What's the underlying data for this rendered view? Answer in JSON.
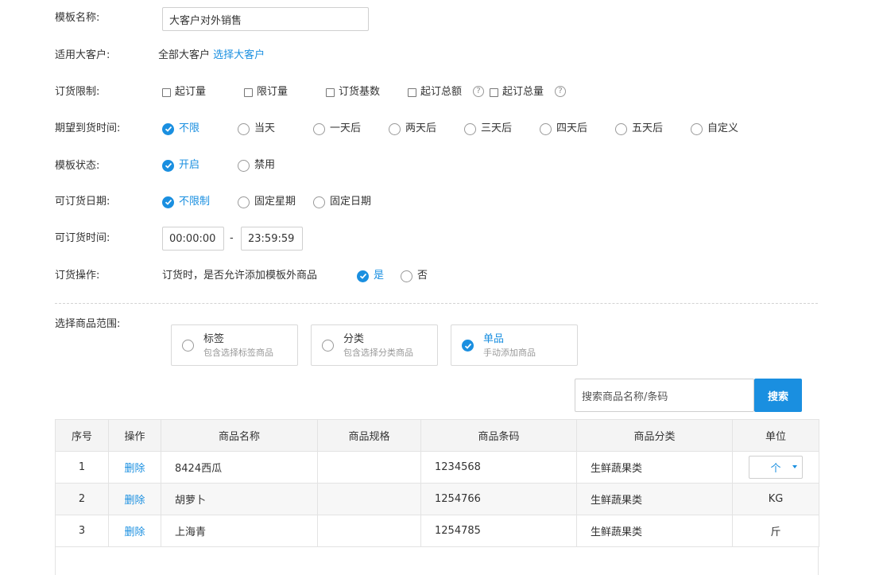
{
  "form": {
    "template_name_label": "模板名称:",
    "template_name_value": "大客户对外销售",
    "customer_label": "适用大客户:",
    "customer_value": "全部大客户",
    "customer_link": "选择大客户",
    "limit_label": "订货限制:",
    "limit_options": [
      "起订量",
      "限订量",
      "订货基数",
      "起订总额",
      "起订总量"
    ],
    "help_glyph": "?",
    "arrival_label": "期望到货时间:",
    "arrival_options": [
      "不限",
      "当天",
      "一天后",
      "两天后",
      "三天后",
      "四天后",
      "五天后",
      "自定义"
    ],
    "arrival_selected": "不限",
    "status_label": "模板状态:",
    "status_options": [
      "开启",
      "禁用"
    ],
    "status_selected": "开启",
    "order_date_label": "可订货日期:",
    "order_date_options": [
      "不限制",
      "固定星期",
      "固定日期"
    ],
    "order_date_selected": "不限制",
    "order_time_label": "可订货时间:",
    "order_time_start": "00:00:00",
    "order_time_sep": "-",
    "order_time_end": "23:59:59",
    "operation_label": "订货操作:",
    "operation_question": "订货时，是否允许添加模板外商品",
    "operation_options": [
      "是",
      "否"
    ],
    "operation_selected": "是"
  },
  "scope": {
    "label": "选择商品范围:",
    "cards": [
      {
        "title": "标签",
        "subtitle": "包含选择标签商品"
      },
      {
        "title": "分类",
        "subtitle": "包含选择分类商品"
      },
      {
        "title": "单品",
        "subtitle": "手动添加商品"
      }
    ],
    "selected": "单品"
  },
  "search": {
    "placeholder": "搜索商品名称/条码",
    "button": "搜索"
  },
  "table": {
    "headers": [
      "序号",
      "操作",
      "商品名称",
      "商品规格",
      "商品条码",
      "商品分类",
      "单位"
    ],
    "rows": [
      {
        "no": "1",
        "action": "删除",
        "name": "8424西瓜",
        "spec": "",
        "barcode": "1234568",
        "category": "生鲜蔬果类",
        "unit": "个"
      },
      {
        "no": "2",
        "action": "删除",
        "name": "胡萝卜",
        "spec": "",
        "barcode": "1254766",
        "category": "生鲜蔬果类",
        "unit": "KG"
      },
      {
        "no": "3",
        "action": "删除",
        "name": "上海青",
        "spec": "",
        "barcode": "1254785",
        "category": "生鲜蔬果类",
        "unit": "斤"
      }
    ]
  },
  "colors": {
    "accent": "#1a8fe0",
    "border": "#cfcfcf",
    "header_bg": "#f4f4f4"
  },
  "icons": {
    "checked": "check-circle-icon",
    "unchecked": "radio-empty-icon",
    "help": "question-circle-icon",
    "caret": "caret-down-icon"
  }
}
